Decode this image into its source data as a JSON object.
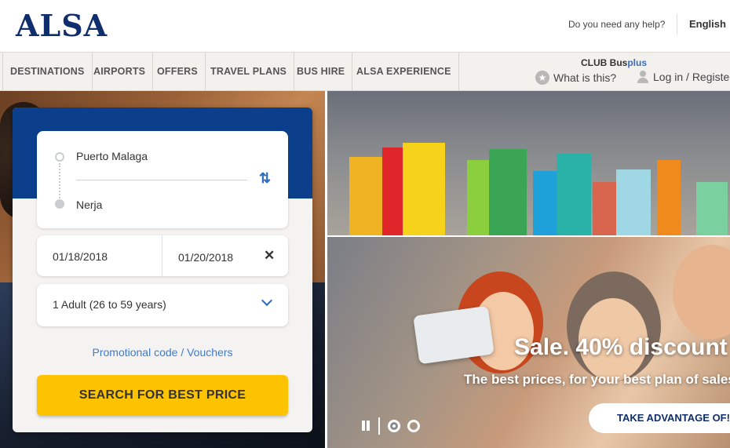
{
  "header": {
    "logo": "ALSA",
    "help_link": "Do you need any help?",
    "language": "English"
  },
  "nav": {
    "items": [
      "DESTINATIONS",
      "AIRPORTS",
      "OFFERS",
      "TRAVEL PLANS",
      "BUS HIRE",
      "ALSA EXPERIENCE"
    ],
    "club_prefix": "CLUB Bus",
    "club_plus": "plus",
    "what_is_this": "What is this?",
    "login": "Log in / Register"
  },
  "search": {
    "origin": "Puerto Malaga",
    "destination": "Nerja",
    "departure_date": "01/18/2018",
    "return_date": "01/20/2018",
    "passengers": "1 Adult (26 to 59 years)",
    "promo_link": "Promotional code / Vouchers",
    "submit_label": "SEARCH FOR BEST PRICE"
  },
  "hero": {
    "title": "Sale. 40% discount",
    "subtitle": "The best prices, for your best plan of sales",
    "cta": "TAKE ADVANTAGE OF!"
  },
  "colors": {
    "brand_navy": "#0f2e6b",
    "widget_blue": "#0b3f8c",
    "button_yellow": "#fdc300",
    "link_blue": "#3b7bd1"
  },
  "icons": [
    "star-icon",
    "user-icon",
    "swap-icon",
    "clear-icon",
    "chevron-down-icon",
    "pause-icon"
  ]
}
